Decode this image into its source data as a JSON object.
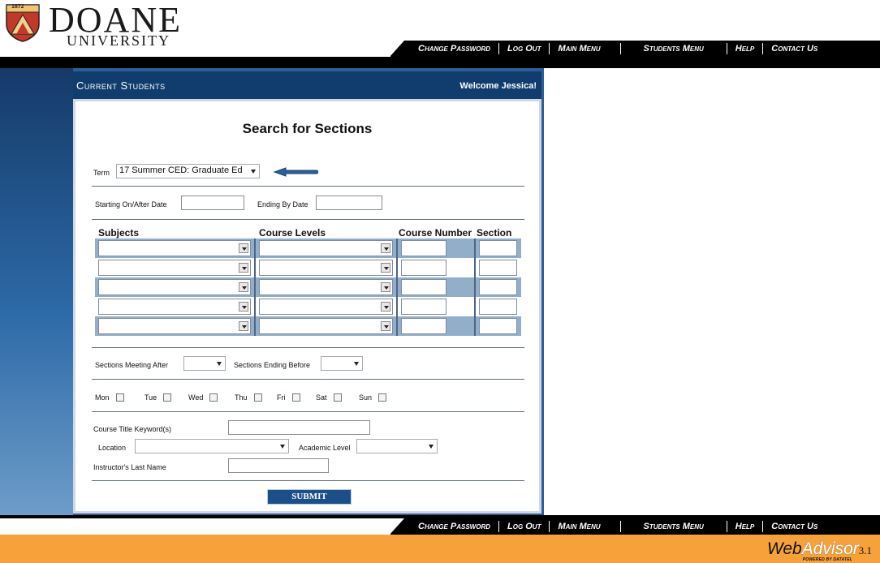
{
  "brand": {
    "year": "1872",
    "name": "DOANE",
    "subtitle": "UNIVERSITY"
  },
  "nav": {
    "change_password": "Change Password",
    "log_out": "Log Out",
    "main_menu": "Main Menu",
    "students_menu": "Students Menu",
    "help": "Help",
    "contact_us": "Contact Us"
  },
  "panel": {
    "title": "Current Students",
    "welcome": "Welcome Jessica!"
  },
  "form": {
    "title": "Search for Sections",
    "term_label": "Term",
    "term_value": "17 Summer CED: Graduate Ed",
    "start_date_label": "Starting On/After Date",
    "end_date_label": "Ending By Date",
    "grid_headers": {
      "subjects": "Subjects",
      "course_levels": "Course Levels",
      "course_number": "Course Number",
      "section": "Section"
    },
    "meeting_after_label": "Sections Meeting After",
    "ending_before_label": "Sections Ending Before",
    "days": [
      "Mon",
      "Tue",
      "Wed",
      "Thu",
      "Fri",
      "Sat",
      "Sun"
    ],
    "keyword_label": "Course Title Keyword(s)",
    "location_label": "Location",
    "academic_level_label": "Academic Level",
    "instructor_label": "Instructor's Last Name",
    "submit_label": "SUBMIT"
  },
  "footer": {
    "brand_web": "Web",
    "brand_advisor": "Advisor",
    "brand_version": "3.1",
    "powered_by": "POWERED BY DATATEL"
  },
  "colors": {
    "nav_bg": "#000000",
    "panel_header": "#113d6e",
    "row_shade": "#93aecb",
    "footer": "#f6a13a",
    "submit_bg": "#1c4f89"
  }
}
